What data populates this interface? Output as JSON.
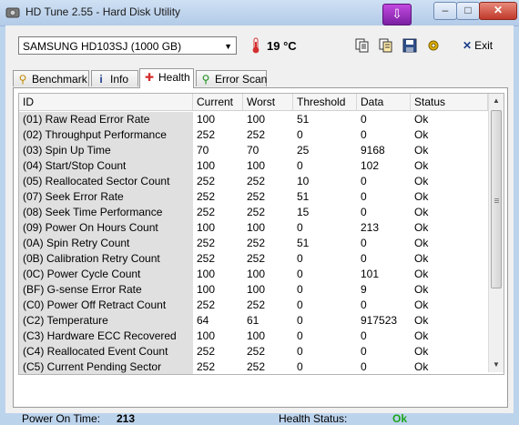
{
  "window": {
    "title": "HD Tune 2.55 - Hard Disk Utility"
  },
  "titlebar": {
    "download_glyph": "⇩",
    "min_glyph": "–",
    "max_glyph": "□",
    "close_glyph": "✕"
  },
  "toolbar": {
    "drive": "SAMSUNG HD103SJ (1000 GB)",
    "temperature": "19 °C",
    "exit_label": "Exit",
    "icons": [
      "copy-icon",
      "copy-all-icon",
      "save-icon",
      "options-icon",
      "exit-icon"
    ]
  },
  "tabs": [
    {
      "label": "Benchmark",
      "icon": "benchmark-icon",
      "glyph": "⚲"
    },
    {
      "label": "Info",
      "icon": "info-icon",
      "glyph": "i"
    },
    {
      "label": "Health",
      "icon": "health-cross-icon",
      "glyph": "✚"
    },
    {
      "label": "Error Scan",
      "icon": "error-scan-icon",
      "glyph": "⚲"
    }
  ],
  "active_tab": "Health",
  "table": {
    "headers": [
      "ID",
      "Current",
      "Worst",
      "Threshold",
      "Data",
      "Status"
    ],
    "rows": [
      [
        "(01) Raw Read Error Rate",
        "100",
        "100",
        "51",
        "0",
        "Ok"
      ],
      [
        "(02) Throughput Performance",
        "252",
        "252",
        "0",
        "0",
        "Ok"
      ],
      [
        "(03) Spin Up Time",
        "70",
        "70",
        "25",
        "9168",
        "Ok"
      ],
      [
        "(04) Start/Stop Count",
        "100",
        "100",
        "0",
        "102",
        "Ok"
      ],
      [
        "(05) Reallocated Sector Count",
        "252",
        "252",
        "10",
        "0",
        "Ok"
      ],
      [
        "(07) Seek Error Rate",
        "252",
        "252",
        "51",
        "0",
        "Ok"
      ],
      [
        "(08) Seek Time Performance",
        "252",
        "252",
        "15",
        "0",
        "Ok"
      ],
      [
        "(09) Power On Hours Count",
        "100",
        "100",
        "0",
        "213",
        "Ok"
      ],
      [
        "(0A) Spin Retry Count",
        "252",
        "252",
        "51",
        "0",
        "Ok"
      ],
      [
        "(0B) Calibration Retry Count",
        "252",
        "252",
        "0",
        "0",
        "Ok"
      ],
      [
        "(0C) Power Cycle Count",
        "100",
        "100",
        "0",
        "101",
        "Ok"
      ],
      [
        "(BF) G-sense Error Rate",
        "100",
        "100",
        "0",
        "9",
        "Ok"
      ],
      [
        "(C0) Power Off Retract Count",
        "252",
        "252",
        "0",
        "0",
        "Ok"
      ],
      [
        "(C2) Temperature",
        "64",
        "61",
        "0",
        "917523",
        "Ok"
      ],
      [
        "(C3) Hardware ECC Recovered",
        "100",
        "100",
        "0",
        "0",
        "Ok"
      ],
      [
        "(C4) Reallocated Event Count",
        "252",
        "252",
        "0",
        "0",
        "Ok"
      ],
      [
        "(C5) Current Pending Sector",
        "252",
        "252",
        "0",
        "0",
        "Ok"
      ]
    ]
  },
  "footer": {
    "power_on_label": "Power On Time:",
    "power_on_value": "213",
    "health_label": "Health Status:",
    "health_value": "Ok"
  },
  "colors": {
    "health_ok": "#1aa51a",
    "temp_icon": "#d32f2f",
    "exit_x": "#1c3e8a"
  }
}
